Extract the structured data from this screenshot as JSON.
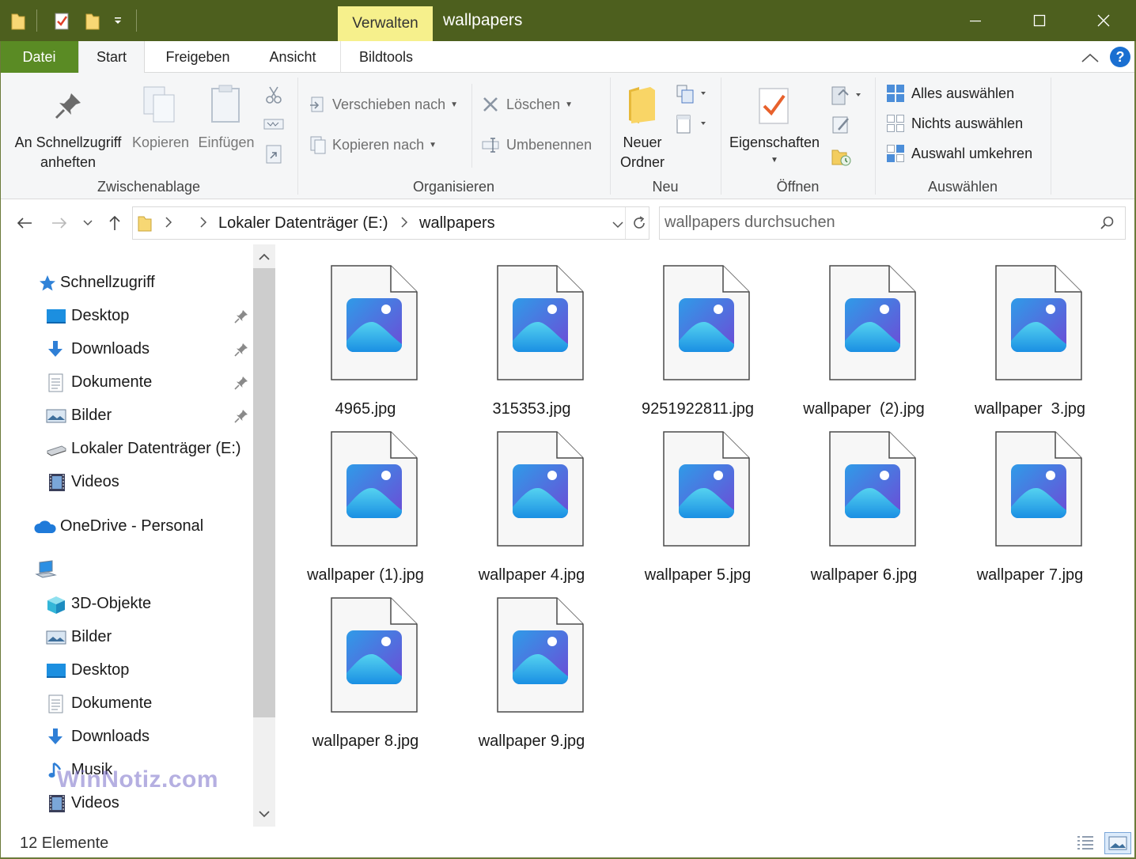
{
  "window": {
    "title": "wallpapers",
    "context_tab": "Verwalten",
    "minimize": "—",
    "maximize": "☐",
    "close": "✕"
  },
  "ribbon_tabs": [
    "Datei",
    "Start",
    "Freigeben",
    "Ansicht",
    "Bildtools"
  ],
  "ribbon": {
    "clipboard": {
      "group": "Zwischenablage",
      "pin_line1": "An Schnellzugriff",
      "pin_line2": "anheften",
      "copy": "Kopieren",
      "paste": "Einfügen"
    },
    "organize": {
      "group": "Organisieren",
      "move_to": "Verschieben nach",
      "copy_to": "Kopieren nach",
      "delete": "Löschen",
      "rename": "Umbenennen"
    },
    "new": {
      "group": "Neu",
      "new_folder_line1": "Neuer",
      "new_folder_line2": "Ordner"
    },
    "open": {
      "group": "Öffnen",
      "properties": "Eigenschaften"
    },
    "select": {
      "group": "Auswählen",
      "select_all": "Alles auswählen",
      "select_none": "Nichts auswählen",
      "invert": "Auswahl umkehren"
    }
  },
  "address": {
    "segments": [
      "Lokaler Datenträger (E:)",
      "wallpapers"
    ],
    "search_placeholder": "wallpapers durchsuchen"
  },
  "nav": {
    "quick_access": "Schnellzugriff",
    "quick_items": [
      "Desktop",
      "Downloads",
      "Dokumente",
      "Bilder",
      "Lokaler Datenträger (E:)",
      "Videos"
    ],
    "onedrive": "OneDrive - Personal",
    "pc_items": [
      "3D-Objekte",
      "Bilder",
      "Desktop",
      "Dokumente",
      "Downloads",
      "Musik",
      "Videos"
    ]
  },
  "watermark": "WinNotiz.com",
  "files": [
    "4965.jpg",
    "315353.jpg",
    "9251922811.jpg",
    "wallpaper  (2).jpg",
    "wallpaper  3.jpg",
    "wallpaper (1).jpg",
    "wallpaper 4.jpg",
    "wallpaper 5.jpg",
    "wallpaper 6.jpg",
    "wallpaper 7.jpg",
    "wallpaper 8.jpg",
    "wallpaper 9.jpg"
  ],
  "status": {
    "count": "12 Elemente"
  },
  "colors": {
    "titlebar": "#4d5f1e",
    "datei_tab": "#5a8b24",
    "context_tab": "#f6f08c",
    "accent_blue": "#1a6fd1"
  },
  "icons": {
    "file": "image-file-icon",
    "pin": "pin-icon"
  }
}
